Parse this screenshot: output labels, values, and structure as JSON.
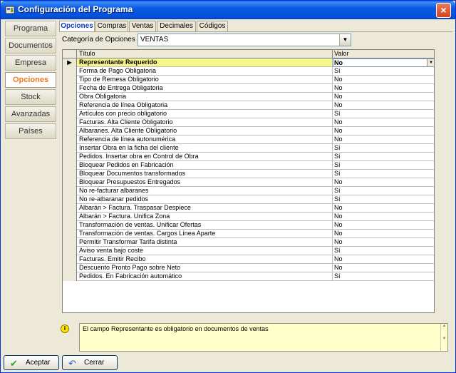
{
  "window": {
    "title": "Configuración del Programa",
    "close_glyph": "×"
  },
  "sidebar": {
    "items": [
      {
        "label": "Programa"
      },
      {
        "label": "Documentos"
      },
      {
        "label": "Empresa"
      },
      {
        "label": "Opciones",
        "active": true
      },
      {
        "label": "Stock"
      },
      {
        "label": "Avanzadas"
      },
      {
        "label": "Países"
      }
    ]
  },
  "tabs": [
    {
      "label": "Opciones",
      "active": true
    },
    {
      "label": "Compras"
    },
    {
      "label": "Ventas"
    },
    {
      "label": "Decimales"
    },
    {
      "label": "Códigos"
    }
  ],
  "category": {
    "label": "Categoría de Opciones",
    "value": "VENTAS"
  },
  "grid": {
    "headers": {
      "title": "Título",
      "value": "Valor"
    },
    "rows": [
      {
        "title": "Representante Requerido",
        "value": "No"
      },
      {
        "title": "Forma de Pago Obligatoria",
        "value": "Sí"
      },
      {
        "title": "Tipo de Remesa Obligatorio",
        "value": "No"
      },
      {
        "title": "Fecha de Entrega Obligatoria",
        "value": "No"
      },
      {
        "title": "Obra Obligatoria",
        "value": "No"
      },
      {
        "title": "Referencia de línea Obligatoria",
        "value": "No"
      },
      {
        "title": "Artículos con precio obligatorio",
        "value": "Sí"
      },
      {
        "title": "Facturas. Alta Cliente Obligatorio",
        "value": "No"
      },
      {
        "title": "Albaranes. Alta Cliente Obligatorio",
        "value": "No"
      },
      {
        "title": "Referencia de línea autonumérica",
        "value": "No"
      },
      {
        "title": "Insertar Obra en la ficha del cliente",
        "value": "Sí"
      },
      {
        "title": "Pedidos. Insertar obra en Control de Obra",
        "value": "Sí"
      },
      {
        "title": "Bloquear Pedidos en Fabricación",
        "value": "Sí"
      },
      {
        "title": "Bloquear Documentos transformados",
        "value": "Sí"
      },
      {
        "title": "Bloquear Presupuestos Entregados",
        "value": "No"
      },
      {
        "title": "No re-facturar albaranes",
        "value": "Sí"
      },
      {
        "title": "No re-albaranar pedidos",
        "value": "Sí"
      },
      {
        "title": "Albarán > Factura. Traspasar Despiece",
        "value": "No"
      },
      {
        "title": "Albarán > Factura. Unifica Zona",
        "value": "No"
      },
      {
        "title": "Transformación de ventas. Unificar Ofertas",
        "value": "No"
      },
      {
        "title": "Transformación de ventas. Cargos Línea Aparte",
        "value": "No"
      },
      {
        "title": "Permitir Transformar Tarifa distinta",
        "value": "No"
      },
      {
        "title": "Aviso venta bajo coste",
        "value": "Sí"
      },
      {
        "title": "Facturas. Emitir Recibo",
        "value": "No"
      },
      {
        "title": "Descuento Pronto Pago sobre Neto",
        "value": "No"
      },
      {
        "title": "Pedidos. En Fabricación automático",
        "value": "Sí"
      }
    ]
  },
  "info": {
    "message": "El campo Representante es obligatorio en documentos de ventas"
  },
  "footer": {
    "accept_label": "Aceptar",
    "cancel_label": "Cerrar"
  },
  "colors": {
    "title_bar": "#0550d8",
    "active_sidebar_text": "#f07a1e",
    "active_tab_text": "#0b39c4",
    "selected_row": "#f7f68a",
    "info_background": "#ffffcc"
  }
}
